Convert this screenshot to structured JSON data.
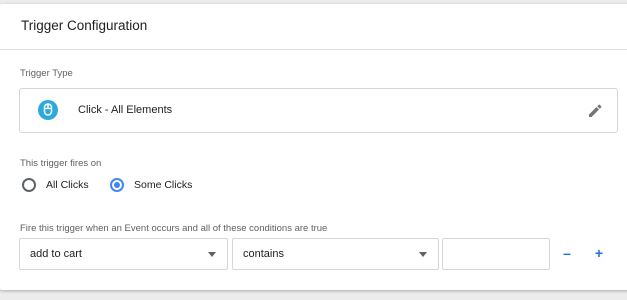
{
  "card": {
    "title": "Trigger Configuration"
  },
  "trigger_type": {
    "label": "Trigger Type",
    "name": "Click - All Elements",
    "icon": "mouse-icon",
    "icon_color": "#2fa8e0"
  },
  "fires_on": {
    "label": "This trigger fires on",
    "options": [
      {
        "label": "All Clicks",
        "selected": false
      },
      {
        "label": "Some Clicks",
        "selected": true
      }
    ]
  },
  "condition": {
    "label": "Fire this trigger when an Event occurs and all of these conditions are true",
    "variable": "add to cart",
    "operator": "contains",
    "value": "",
    "remove_label": "–",
    "add_label": "+"
  },
  "colors": {
    "accent": "#1a73e8",
    "radio_selected": "#4285f4"
  }
}
